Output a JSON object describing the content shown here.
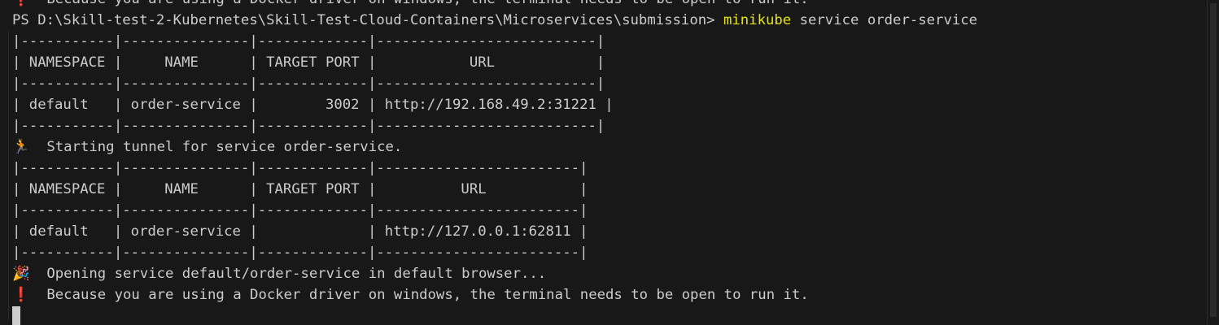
{
  "terminal": {
    "partial_warning": "❗  Because you are using a Docker driver on windows, the terminal needs to be open to run it.",
    "prompt": "PS D:\\Skill-test-2-Kubernetes\\Skill-Test-Cloud-Containers\\Microservices\\submission> ",
    "command": "minikube",
    "command_args": " service order-service",
    "table1": {
      "border": "|-----------|---------------|-------------|--------------------------|",
      "header": "| NAMESPACE |     NAME      | TARGET PORT |           URL            |",
      "row": "| default   | order-service |        3002 | http://192.168.49.2:31221 |"
    },
    "tunnel_icon": "🏃",
    "tunnel_msg": "  Starting tunnel for service order-service.",
    "table2": {
      "border": "|-----------|---------------|-------------|------------------------|",
      "header": "| NAMESPACE |     NAME      | TARGET PORT |          URL           |",
      "row": "| default   | order-service |             | http://127.0.0.1:62811 |"
    },
    "open_icon": "🎉",
    "open_msg": "  Opening service default/order-service in default browser...",
    "warn_icon": "❗",
    "warn_msg": "  Because you are using a Docker driver on windows, the terminal needs to be open to run it."
  }
}
